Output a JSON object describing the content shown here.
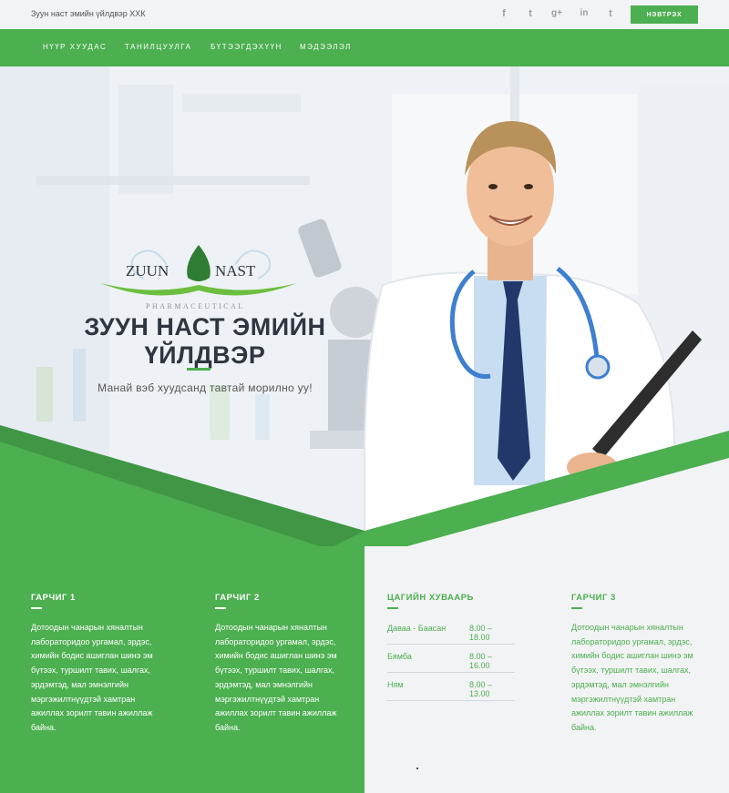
{
  "topbar": {
    "company": "Зуун наст эмийн үйлдвэр ХХК",
    "social": [
      {
        "icon": "facebook-icon",
        "glyph": "f"
      },
      {
        "icon": "twitter-icon",
        "glyph": "t"
      },
      {
        "icon": "google-plus-icon",
        "glyph": "g+"
      },
      {
        "icon": "linkedin-icon",
        "glyph": "in"
      },
      {
        "icon": "tumblr-icon",
        "glyph": "t"
      }
    ],
    "login_label": "НЭВТРЭХ"
  },
  "nav": {
    "items": [
      "НҮҮР ХУУДАС",
      "ТАНИЛЦУУЛГА",
      "БҮТЭЭГДЭХҮҮН",
      "МЭДЭЭЛЭЛ"
    ]
  },
  "hero": {
    "logo_left": "ZUUN",
    "logo_right": "NAST",
    "logo_sub": "PHARMACEUTICAL",
    "title_line1": "ЗУУН НАСТ ЭМИЙН",
    "title_line2": "ҮЙЛДВЭР",
    "subtitle": "Манай вэб хуудсанд тавтай морилно уу!"
  },
  "columns": {
    "col1": {
      "heading": "ГАРЧИГ 1",
      "text": "Дотоодын чанарын хяналтын лабораторидоо ургамал, эрдэс, химийн бодис ашиглан шинэ эм бүтээх, туршилт тавих, шалгах, эрдэмтэд, мал эмнэлгийн мэргэжилтнүүдтэй хамтран ажиллах зорилт тавин ажиллаж байна."
    },
    "col2": {
      "heading": "ГАРЧИГ 2",
      "text": "Дотоодын чанарын хяналтын лабораторидоо ургамал, эрдэс, химийн бодис ашиглан шинэ эм бүтээх, туршилт тавих, шалгах, эрдэмтэд, мал эмнэлгийн мэргэжилтнүүдтэй хамтран ажиллах зорилт тавин ажиллаж байна."
    },
    "schedule": {
      "heading": "ЦАГИЙН ХУВААРЬ",
      "rows": [
        {
          "day": "Даваа - Баасан",
          "time": "8.00 – 18.00"
        },
        {
          "day": "Бямба",
          "time": "8.00 – 16.00"
        },
        {
          "day": "Ням",
          "time": "8.00 – 13.00"
        }
      ]
    },
    "col3": {
      "heading": "ГАРЧИГ 3",
      "text": "Дотоодын чанарын хяналтын лабораторидоо ургамал, эрдэс, химийн бодис ашиглан шинэ эм бүтээх, туршилт тавих, шалгах, эрдэмтэд, мал эмнэлгийн мэргэжилтнүүдтэй хамтран ажиллах зорилт тавин ажиллаж байна."
    }
  },
  "colors": {
    "brand_green": "#4caf50",
    "dark_text": "#2f3640",
    "light_bg": "#f2f3f4"
  }
}
